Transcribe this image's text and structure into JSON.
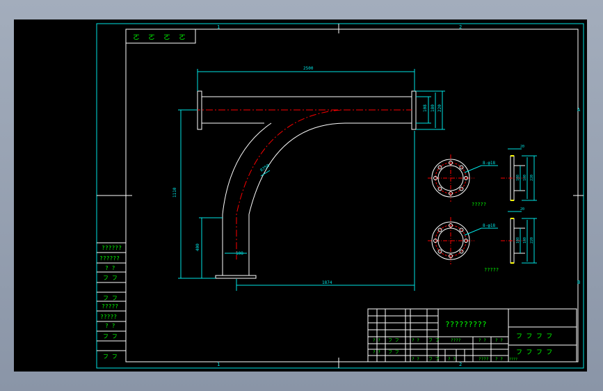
{
  "drawing": {
    "title_block_text": "?????????",
    "zone_labels": {
      "top_1": "1",
      "top_2": "2",
      "bottom_1": "1",
      "bottom_2": "2",
      "right_a": "A",
      "right_b": "B"
    },
    "dimensions": {
      "top_length": "2500",
      "vertical_height": "1110",
      "lower_length": "1874",
      "lower_left_height": "400",
      "pipe_dia": "108",
      "bend_radius": "R750",
      "right_dia_1": "108",
      "right_dia_2": "180",
      "right_dia_3": "220",
      "upper_side_w": "20",
      "upper_side_1": "108",
      "upper_side_2": "180",
      "upper_side_3": "220",
      "lower_side_w": "20",
      "lower_side_1": "108",
      "lower_side_2": "180",
      "lower_side_3": "220"
    },
    "flange_notes": {
      "upper_hole": "8-φ18",
      "lower_hole": "8-φ18"
    },
    "flange_captions": {
      "upper": "?????",
      "lower": "?????"
    },
    "left_column_labels": [
      "??????",
      "??????",
      "? ?",
      "フ フ",
      "フ フ",
      "?????",
      "?????",
      "? ?",
      "フ フ",
      "フ フ"
    ],
    "top_left_box": [
      "ㄛ",
      "ㄛ",
      "ㄛ",
      "ㄛ"
    ],
    "title_block": {
      "cells_row1": [
        "? ?",
        "フ フ",
        "? ?",
        "フ フ"
      ],
      "cells_row2": [
        "? ?",
        "フ フ",
        "? ?",
        "フ フ"
      ],
      "mid_labels": [
        "????",
        "? ?",
        "? ?"
      ],
      "right_labels": [
        "フ フ フ フ",
        "フ フ フ フ"
      ],
      "bottom_labels": [
        "? ?",
        "????",
        "? ?"
      ],
      "footer": "????"
    }
  },
  "colors": {
    "frame": "#00e5e5",
    "cyan": "#00e5e5",
    "white": "#ffffff",
    "red": "#ff0000",
    "green": "#00ff00",
    "yellow": "#ffff00"
  }
}
